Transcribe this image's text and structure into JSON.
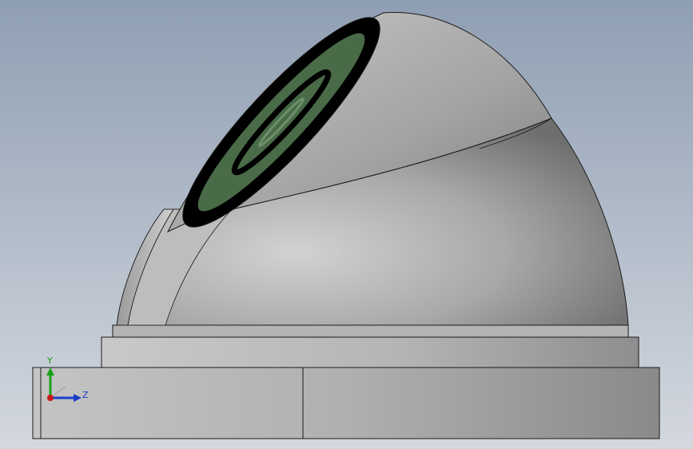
{
  "viewport": {
    "background_top": "#8f9fb3",
    "background_bottom": "#d4d8df"
  },
  "model": {
    "body_color": "#a9a9a9",
    "body_highlight": "#d2d2d2",
    "body_shadow": "#6e6e6e",
    "lens_ring_color": "#000000",
    "lens_glass_color": "#4a6b48",
    "edge_color": "#1a1a1a"
  },
  "triad": {
    "y_label": "Y",
    "z_label": "Z",
    "y_color": "#1aa01a",
    "z_color": "#1a3ec8",
    "origin_color": "#c81a1a"
  }
}
